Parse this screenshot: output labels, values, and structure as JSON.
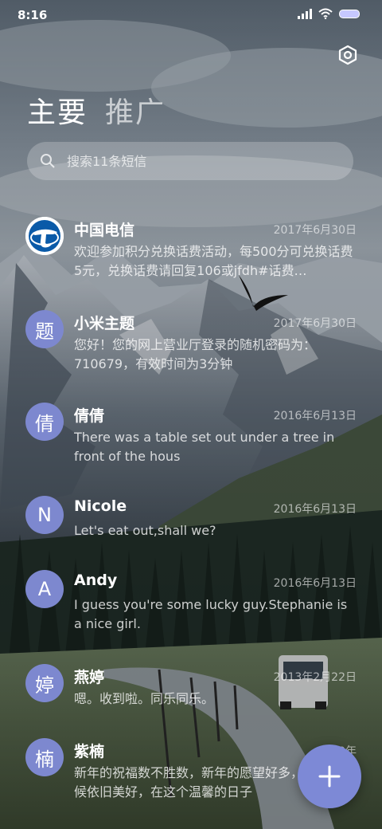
{
  "status_bar": {
    "time": "8:16",
    "icons": [
      "signal-icon",
      "wifi-icon",
      "battery-icon"
    ]
  },
  "header": {
    "settings_icon": "settings-hex-icon",
    "tabs": [
      {
        "label": "主要",
        "active": true
      },
      {
        "label": "推广",
        "active": false
      }
    ]
  },
  "search": {
    "placeholder": "搜索11条短信",
    "value": "",
    "icon": "search-icon"
  },
  "messages": [
    {
      "avatar": "",
      "avatar_icon": "china-telecom-logo",
      "name": "中国电信",
      "date": "2017年6月30日",
      "preview": "欢迎参加积分兑换话费活动，每500分可兑换话费5元，兑换话费请回复106或jfdh#话费…"
    },
    {
      "avatar": "题",
      "name": "小米主题",
      "date": "2017年6月30日",
      "preview": "您好！您的网上营业厅登录的随机密码为：710679，有效时间为3分钟"
    },
    {
      "avatar": "倩",
      "name": "倩倩",
      "date": "2016年6月13日",
      "preview": "There was a table set out under a tree in front of the hous"
    },
    {
      "avatar": "N",
      "name": "Nicole",
      "date": "2016年6月13日",
      "preview": "Let's eat out,shall we?"
    },
    {
      "avatar": "A",
      "name": "Andy",
      "date": "2016年6月13日",
      "preview": "I guess you're some lucky guy.Stephanie is a nice girl."
    },
    {
      "avatar": "婷",
      "name": "燕婷",
      "date": "2013年2月22日",
      "preview": "嗯。收到啦。同乐同乐。"
    },
    {
      "avatar": "楠",
      "name": "紫楠",
      "date": "2013年",
      "preview": "新年的祝福数不胜数，新年的愿望好多，新年的问候依旧美好，在这个温馨的日子"
    }
  ],
  "fab": {
    "icon": "plus-icon"
  },
  "colors": {
    "avatar_bg": "#7d88cf",
    "fab_bg": "#7d89d6",
    "telecom_blue": "#0a5aa8"
  }
}
